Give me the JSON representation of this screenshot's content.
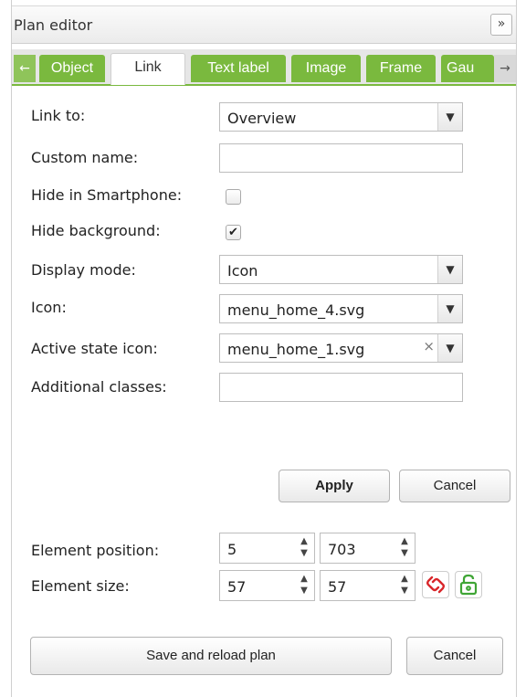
{
  "panel": {
    "title": "Plan editor",
    "collapse_label": "»"
  },
  "tabs": {
    "left_arrow": "←",
    "right_arrow": "→",
    "items": [
      {
        "label": "Object"
      },
      {
        "label": "Link"
      },
      {
        "label": "Text label"
      },
      {
        "label": "Image"
      },
      {
        "label": "Frame"
      },
      {
        "label": "Gau"
      }
    ],
    "active_index": 1
  },
  "form": {
    "link_to": {
      "label": "Link to:",
      "value": "Overview"
    },
    "custom_name": {
      "label": "Custom name:",
      "value": ""
    },
    "hide_smartphone": {
      "label": "Hide in Smartphone:",
      "checked": false
    },
    "hide_background": {
      "label": "Hide background:",
      "checked": true,
      "mark": "✔"
    },
    "display_mode": {
      "label": "Display mode:",
      "value": "Icon"
    },
    "icon": {
      "label": "Icon:",
      "value": "menu_home_4.svg"
    },
    "active_state_icon": {
      "label": "Active state icon:",
      "value": "menu_home_1.svg",
      "clear": "×"
    },
    "additional_classes": {
      "label": "Additional classes:",
      "value": ""
    }
  },
  "actions": {
    "apply": "Apply",
    "cancel": "Cancel"
  },
  "element": {
    "position": {
      "label": "Element position:",
      "x": "5",
      "y": "703"
    },
    "size": {
      "label": "Element size:",
      "w": "57",
      "h": "57"
    }
  },
  "footer": {
    "save_reload": "Save and reload plan",
    "cancel": "Cancel"
  },
  "colors": {
    "tab_green": "#7ab93e",
    "link_icon_red": "#d9262a",
    "lock_icon_green": "#3fa535"
  }
}
